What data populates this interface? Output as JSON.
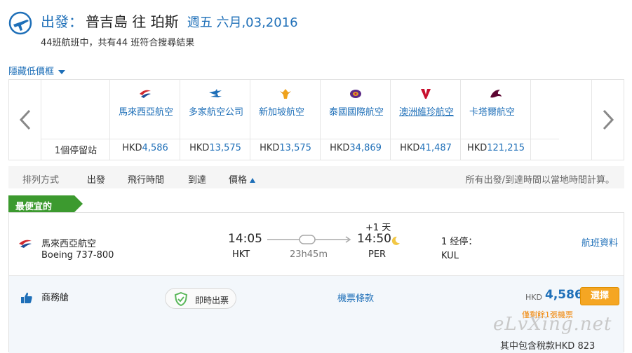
{
  "header": {
    "label": "出發：",
    "route": "普吉島 往 珀斯",
    "date": "週五 六月,03,2016",
    "summary": "44班航班中，共有44 班符合搜尋結果"
  },
  "toggle_label": "隱藏低價框",
  "matrix": {
    "row_label": "1個停留站",
    "columns": [
      {
        "name": "馬來西亞航空",
        "currency": "HKD",
        "amount": "4,586",
        "icon": "malaysia-airlines-logo",
        "color": "#d0282e"
      },
      {
        "name": "多家航空公司",
        "currency": "HKD",
        "amount": "13,575",
        "icon": "multi-airline-planes-logo",
        "color": "#1e6fb8"
      },
      {
        "name": "新加坡航空",
        "currency": "HKD",
        "amount": "13,575",
        "icon": "singapore-airlines-logo",
        "color": "#f0a31b"
      },
      {
        "name": "泰國國際航空",
        "currency": "HKD",
        "amount": "34,869",
        "icon": "thai-airways-logo",
        "color": "#5b2a86"
      },
      {
        "name": "澳洲維珍航空",
        "currency": "HKD",
        "amount": "41,487",
        "icon": "virgin-australia-logo",
        "color": "#c8102e"
      },
      {
        "name": "卡塔爾航空",
        "currency": "HKD",
        "amount": "121,215",
        "icon": "qatar-airways-logo",
        "color": "#5c0632"
      }
    ]
  },
  "sortbar": {
    "label": "排列方式",
    "options": [
      "出發",
      "飛行時間",
      "到達",
      "價格"
    ],
    "note": "所有出發/到達時間以當地時間計算。"
  },
  "badge": "最便宜的",
  "flight": {
    "airline": "馬來西亞航空",
    "aircraft": "Boeing 737-800",
    "depart_time": "14:05",
    "depart_code": "HKT",
    "arrive_time": "14:50",
    "arrive_code": "PER",
    "plus_day": "+1 天",
    "duration": "23h45m",
    "stops": "1 经停：",
    "stop_code": "KUL",
    "details": "航班資料",
    "cabin": "商務艙",
    "instant": "即時出票",
    "terms": "機票條款",
    "currency": "HKD",
    "fare": "4,586",
    "select": "選擇",
    "remain": "僅剩餘1張機票",
    "tax": "其中包含稅款HKD 823"
  },
  "watermark": "eLvXing.net",
  "colors": {
    "accent": "#1e6fb8",
    "badge_green": "#3c9a2f",
    "button_orange": "#f5a623"
  }
}
